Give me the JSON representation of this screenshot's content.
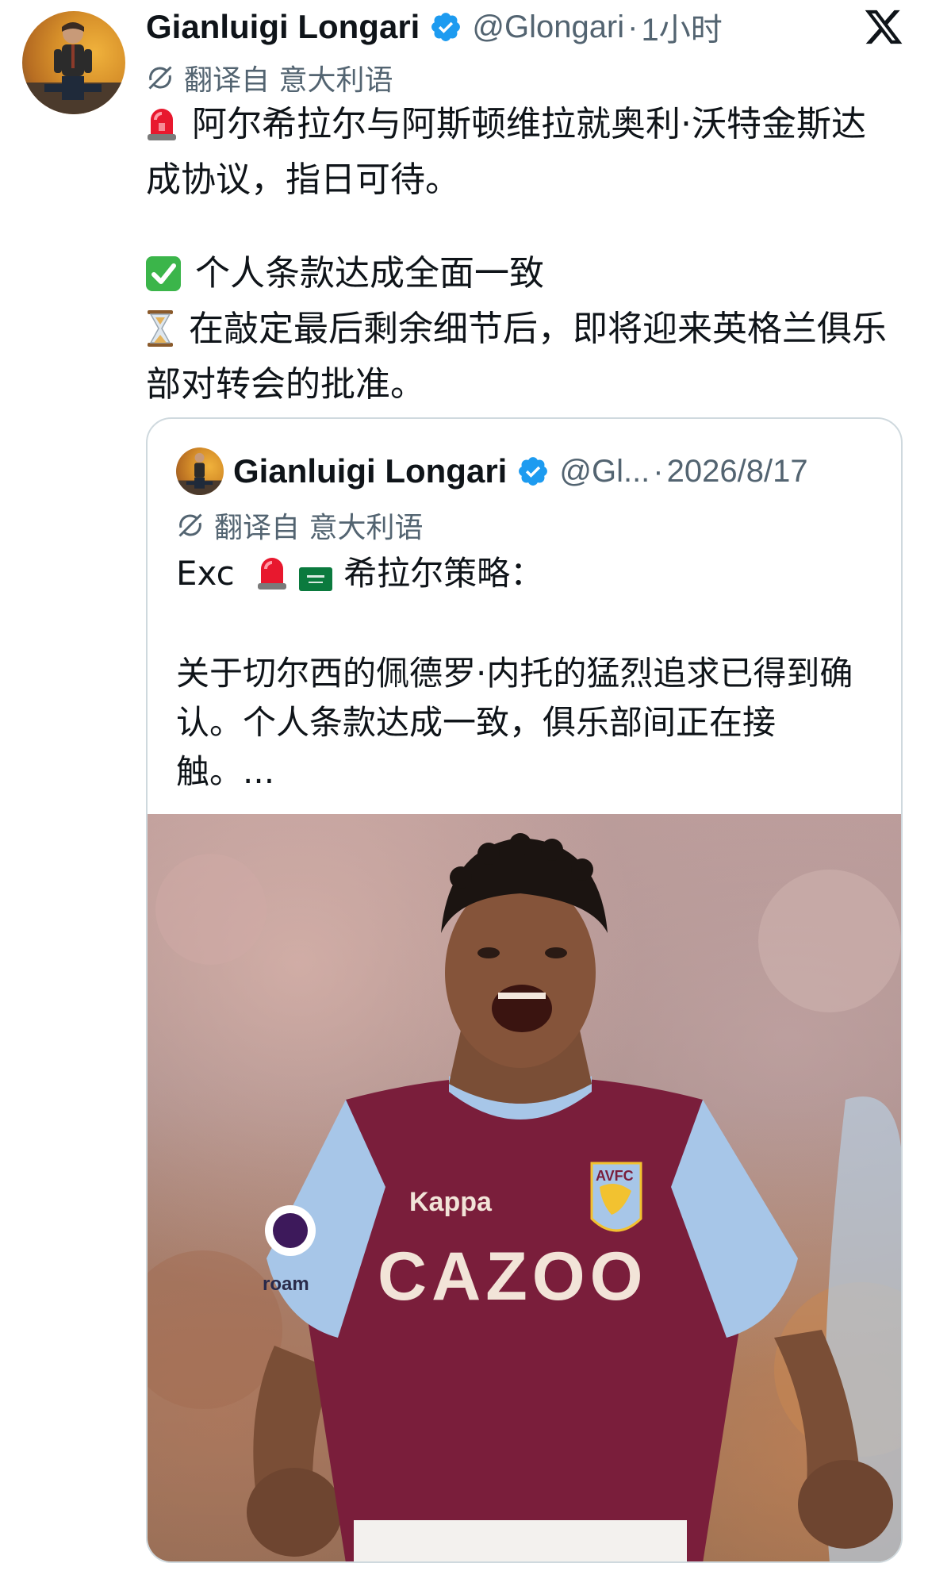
{
  "tweet": {
    "author": {
      "name": "Gianluigi Longari",
      "handle": "@Glongari",
      "separator": "·",
      "time": "1小时"
    },
    "translation_note": "翻译自 意大利语",
    "body": {
      "line1": "阿尔希拉尔与阿斯顿维拉就奥利·沃特金斯达成协议，指日可待。",
      "line2": "个人条款达成全面一致",
      "line3": "在敲定最后剩余细节后，即将迎来英格兰俱乐部对转会的批准。"
    },
    "icons": {
      "verified": "verified-badge-icon",
      "x_logo": "x-logo-icon",
      "translate": "translate-icon",
      "siren": "police-light-emoji",
      "check": "check-mark-emoji",
      "hourglass": "hourglass-emoji"
    }
  },
  "quoted": {
    "author": {
      "name": "Gianluigi Longari",
      "handle": "@Gl...",
      "separator": "·",
      "date": "2026/8/17"
    },
    "translation_note": "翻译自 意大利语",
    "text": {
      "line1_prefix": "Exc",
      "line1_suffix": "希拉尔策略：",
      "line2": "关于切尔西的佩德罗·内托的猛烈追求已得到确认。个人条款达成一致，俱乐部间正在接触。..."
    },
    "media": {
      "description_alt": "",
      "jersey_sponsor": "CAZOO",
      "badge_text": "AVFC",
      "kit_brand": "Kappa",
      "sleeve_text": "roam"
    }
  },
  "colors": {
    "text": "#0f1419",
    "secondary": "#536471",
    "verified_blue": "#1d9bf0",
    "border": "#cfd9de",
    "claret": "#7a1e3b",
    "sky_blue": "#a7c6e8"
  }
}
